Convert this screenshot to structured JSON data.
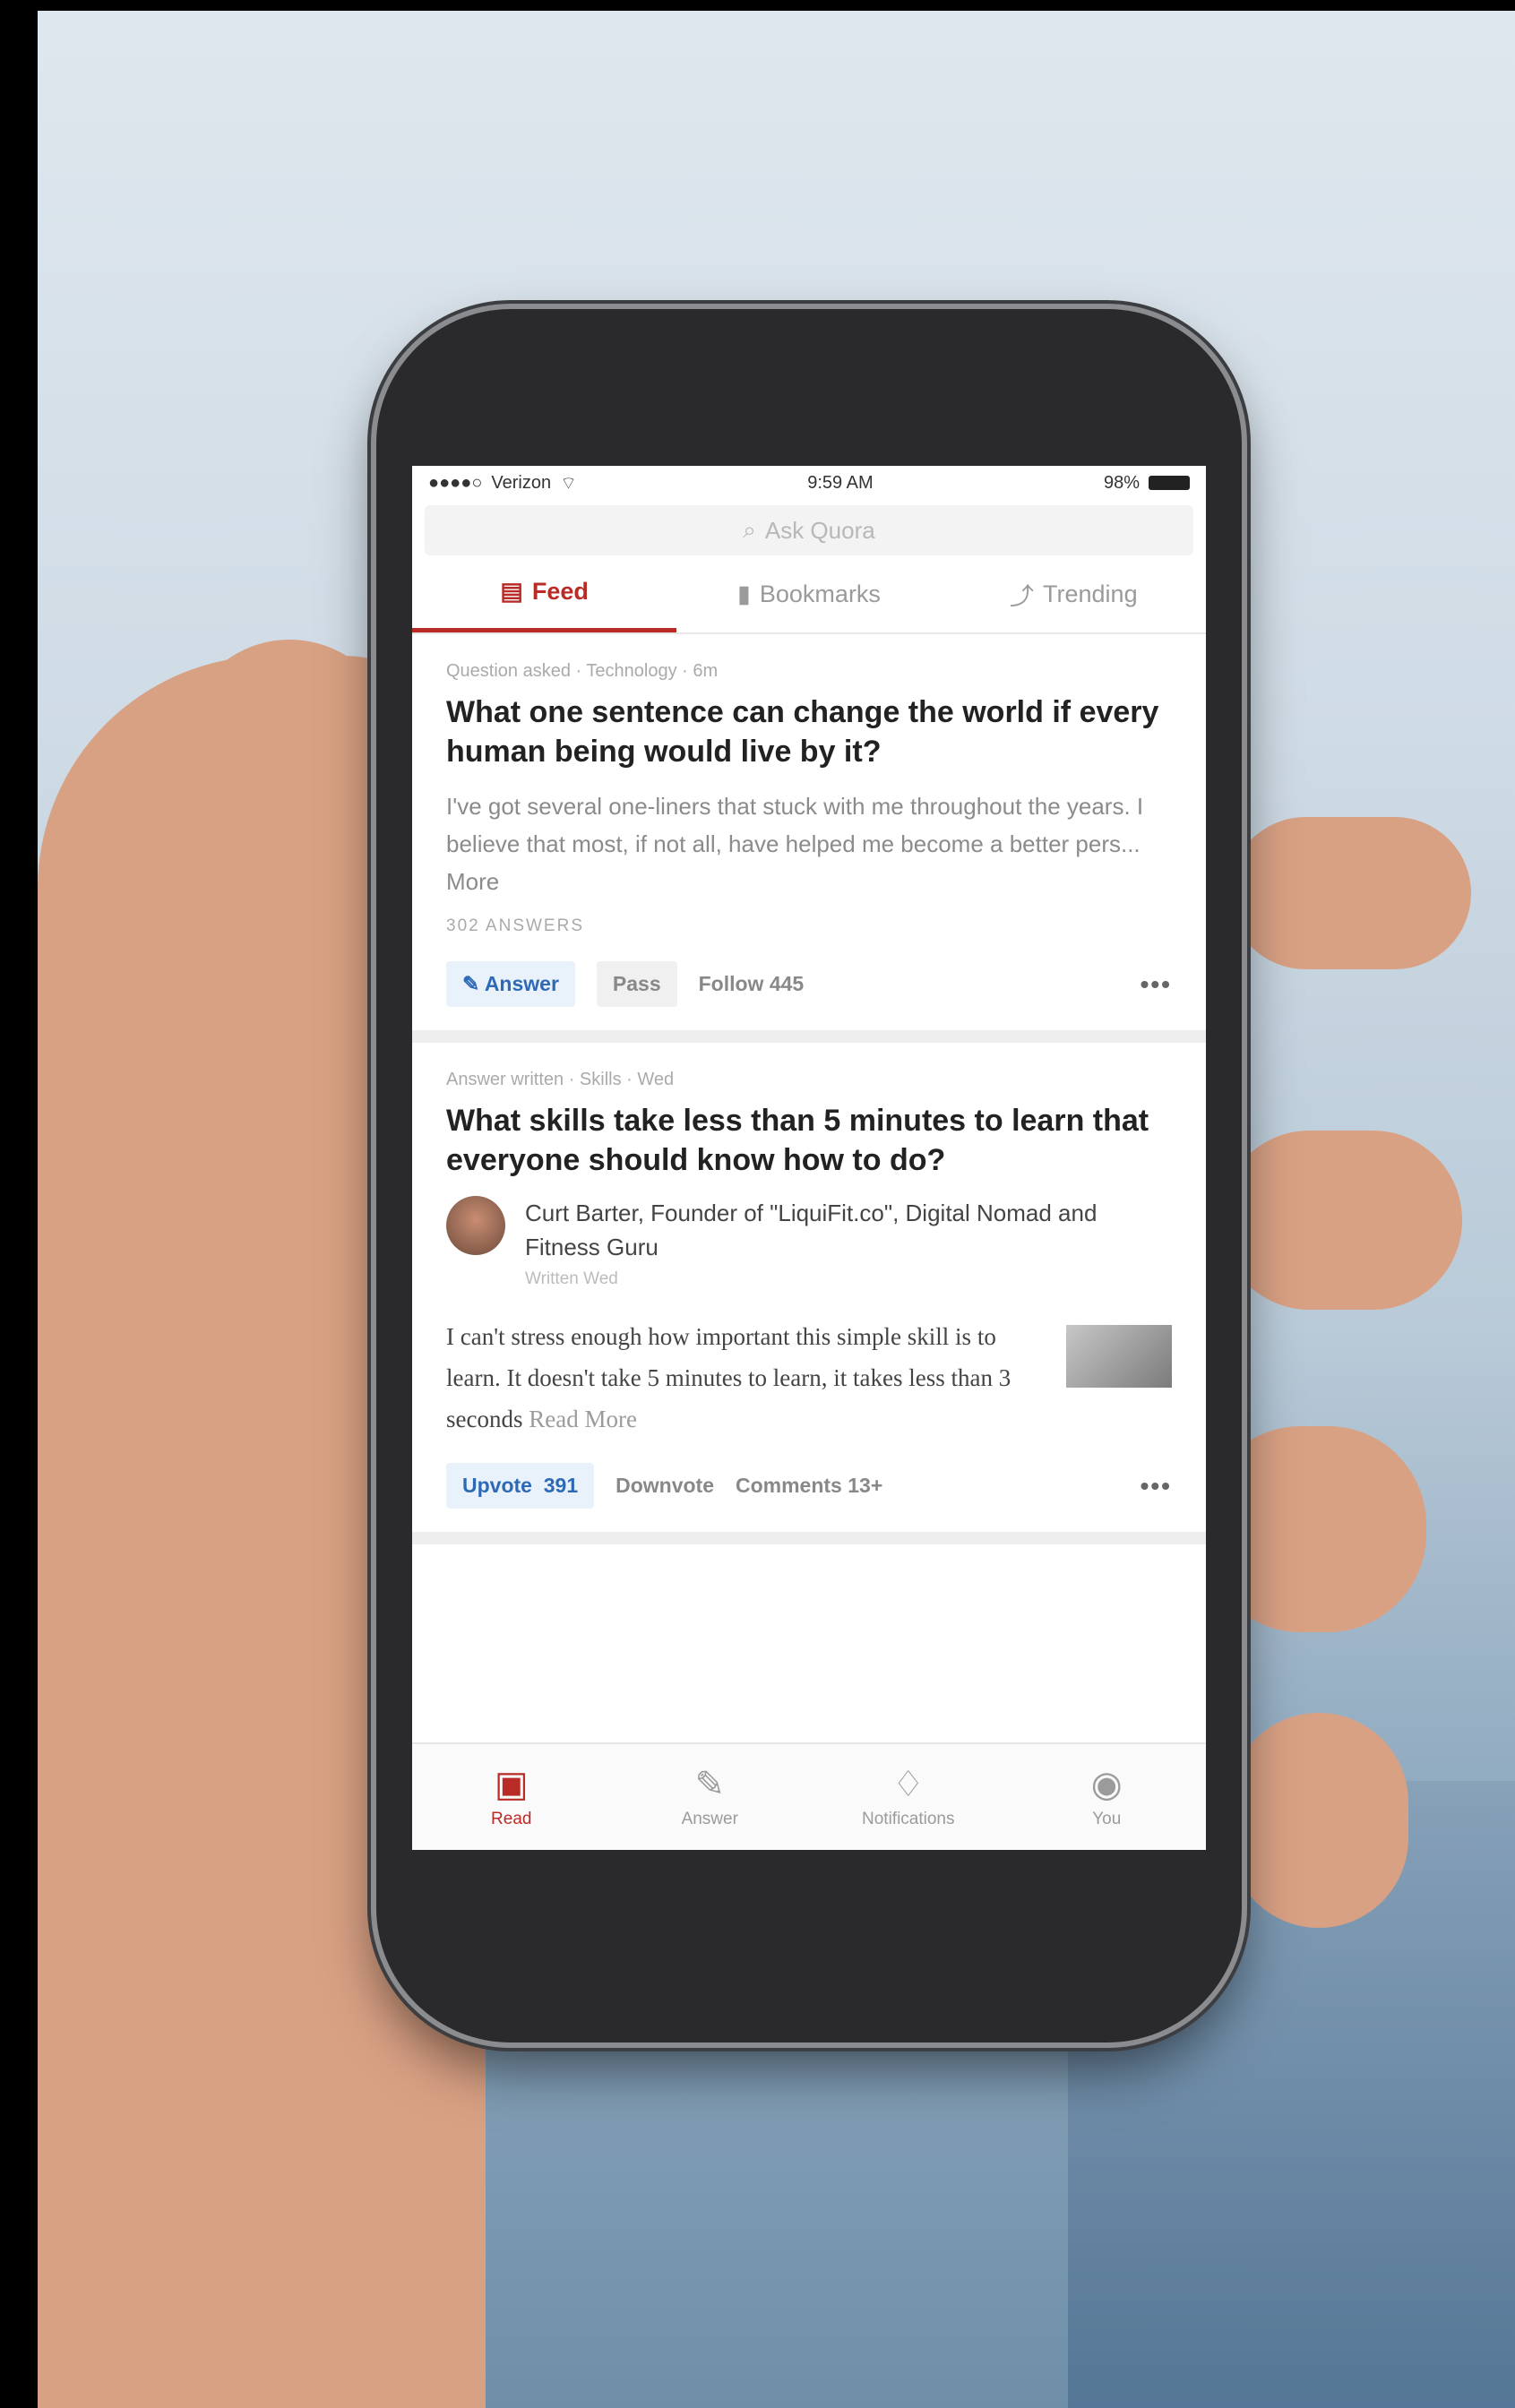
{
  "status_bar": {
    "carrier": "Verizon",
    "time": "9:59 AM",
    "battery": "98%"
  },
  "search": {
    "placeholder": "Ask Quora",
    "icon": "search-icon"
  },
  "tabs": [
    {
      "label": "Feed",
      "icon": "feed-icon",
      "active": true
    },
    {
      "label": "Bookmarks",
      "icon": "bookmark-icon",
      "active": false
    },
    {
      "label": "Trending",
      "icon": "trending-icon",
      "active": false
    }
  ],
  "feed": [
    {
      "meta": "Question asked · Technology · 6m",
      "title": "What one sentence can change the world if every human being would live by it?",
      "excerpt": "I've got several one-liners that stuck with me throughout the years. I believe that most, if not all, have helped me become a better pers... More",
      "answers_count": "302 ANSWERS",
      "actions": {
        "answer": "Answer",
        "pass": "Pass",
        "follow": "Follow",
        "follow_count": "445"
      }
    },
    {
      "meta": "Answer written · Skills · Wed",
      "title": "What skills take less than 5 minutes to learn that everyone should know how to do?",
      "author_name": "Curt Barter, Founder of \"LiquiFit.co\", Digital Nomad and Fitness Guru",
      "author_sub": "Written Wed",
      "excerpt": "I can't stress enough how important this simple skill is to learn. It doesn't take 5 minutes to learn, it takes less than 3 seconds",
      "read_more": "Read More",
      "actions": {
        "upvote": "Upvote",
        "upvote_count": "391",
        "downvote": "Downvote",
        "comments": "Comments",
        "comments_count": "13+"
      }
    }
  ],
  "bottom_nav": [
    {
      "label": "Read",
      "icon": "read-icon",
      "active": true
    },
    {
      "label": "Answer",
      "icon": "edit-icon",
      "active": false
    },
    {
      "label": "Notifications",
      "icon": "bell-icon",
      "active": false
    },
    {
      "label": "You",
      "icon": "profile-icon",
      "active": false
    }
  ],
  "colors": {
    "accent": "#b92b27",
    "link_blue": "#2e69b6"
  }
}
